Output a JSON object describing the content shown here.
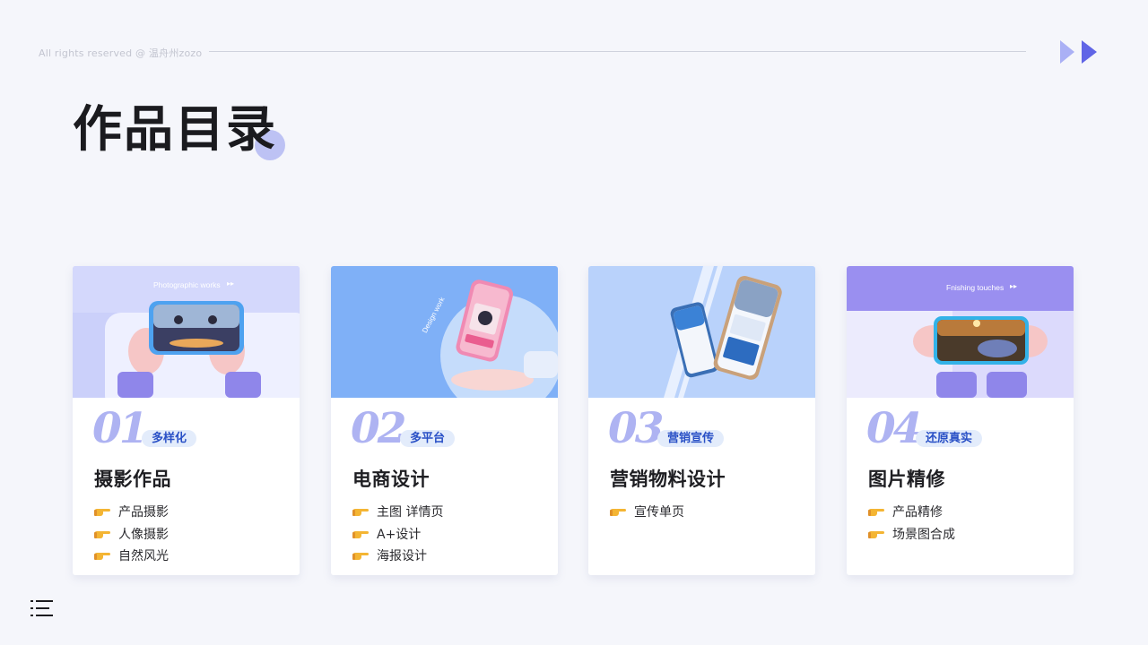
{
  "header": {
    "copyright": "All rights reserved @ 温舟州zozo",
    "title": "作品目录",
    "nav_icon": "double-chevron-right-icon"
  },
  "footer": {
    "menu_icon": "list-menu-icon"
  },
  "colors": {
    "accent": "#aeb3f2",
    "badge_text": "#2950c6",
    "badge_bg": "#e3ecfb",
    "background": "#f5f6fb"
  },
  "cards": [
    {
      "number": "01",
      "badge": "多样化",
      "title": "摄影作品",
      "image_caption": "Photographic works",
      "items": [
        "产品摄影",
        "人像摄影",
        "自然风光"
      ]
    },
    {
      "number": "02",
      "badge": "多平台",
      "title": "电商设计",
      "image_caption": "Design work",
      "items": [
        "主图 详情页",
        "A+设计",
        "海报设计"
      ]
    },
    {
      "number": "03",
      "badge": "营销宣传",
      "title": "营销物料设计",
      "image_caption": "",
      "items": [
        "宣传单页"
      ]
    },
    {
      "number": "04",
      "badge": "还原真实",
      "title": "图片精修",
      "image_caption": "Fnishing touches",
      "items": [
        "产品精修",
        "场景图合成"
      ]
    }
  ]
}
